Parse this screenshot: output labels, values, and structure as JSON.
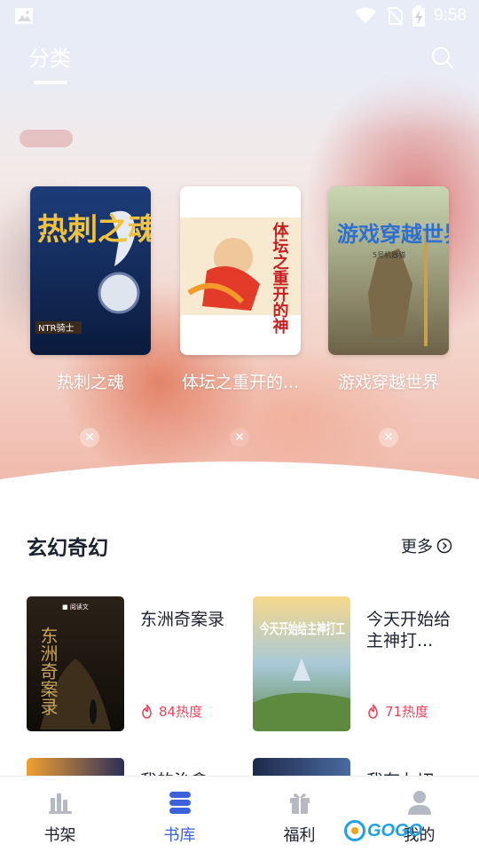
{
  "status_bar": {
    "time": "9:58"
  },
  "header": {
    "active_tab": "分类"
  },
  "featured": [
    {
      "title": "热刺之魂",
      "cover_text": "热刺之魂",
      "cover_author": "NTR骑士"
    },
    {
      "title": "体坛之重开的...",
      "cover_text": "体坛之重开的神"
    },
    {
      "title": "游戏穿越世界",
      "cover_text": "游戏穿越世界",
      "cover_author": "5号机器猫"
    }
  ],
  "section": {
    "title": "玄幻奇幻",
    "more_label": "更多",
    "books": [
      {
        "title": "东洲奇案录",
        "heat": "84热度",
        "cover_text": "东洲奇案录"
      },
      {
        "title": "今天开始给主神打...",
        "heat": "71热度",
        "cover_text": "今天开始给主神打工"
      },
      {
        "title": "我的治愈",
        "heat": ""
      },
      {
        "title": "我有九切",
        "heat": ""
      }
    ]
  },
  "bottom_nav": [
    {
      "label": "书架",
      "icon": "bookshelf-icon",
      "active": false
    },
    {
      "label": "书库",
      "icon": "library-icon",
      "active": true
    },
    {
      "label": "福利",
      "icon": "gift-icon",
      "active": false
    },
    {
      "label": "我的",
      "icon": "profile-icon",
      "active": false
    }
  ],
  "watermark": {
    "text": "GOGO"
  },
  "colors": {
    "accent": "#3b62d9",
    "heat": "#e9465a",
    "inactive_icon": "#b4b9c4"
  }
}
